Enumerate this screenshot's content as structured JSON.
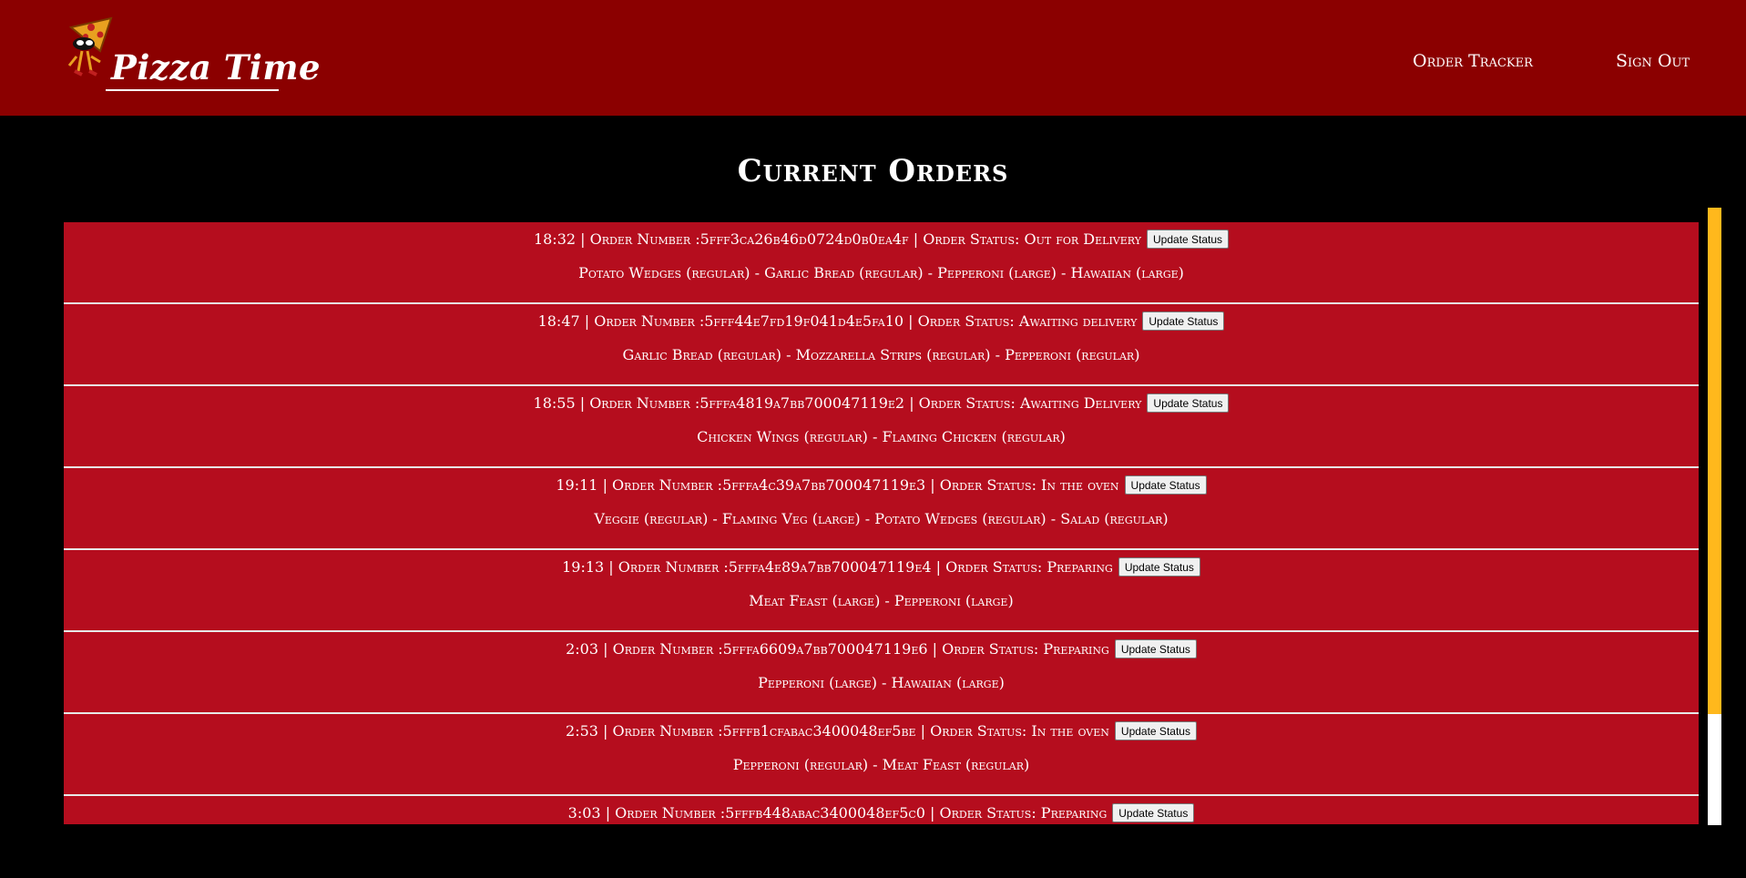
{
  "header": {
    "logo_text": "Pizza Time",
    "nav": {
      "tracker": "Order Tracker",
      "signout": "Sign Out"
    }
  },
  "page": {
    "title": "Current Orders"
  },
  "orders": [
    {
      "line": "18:32 | Order Number :5fff3ca26b46d0724d0b0ea4f | Order Status: Out for Delivery",
      "items": "Potato Wedges (regular) - Garlic Bread (regular) - Pepperoni (large) - Hawaiian (large)",
      "button": "Update Status"
    },
    {
      "line": "18:47 | Order Number :5fff44e7fd19f041d4e5fa10 | Order Status: Awaiting delivery",
      "items": "Garlic Bread (regular) - Mozzarella Strips (regular) - Pepperoni (regular)",
      "button": "Update Status"
    },
    {
      "line": "18:55 | Order Number :5fffa4819a7bb700047119e2 | Order Status: Awaiting Delivery",
      "items": "Chicken Wings (regular) - Flaming Chicken (regular)",
      "button": "Update Status"
    },
    {
      "line": "19:11 | Order Number :5fffa4c39a7bb700047119e3 | Order Status: In the oven",
      "items": "Veggie (regular) - Flaming Veg (large) - Potato Wedges (regular) - Salad (regular)",
      "button": "Update Status"
    },
    {
      "line": "19:13 | Order Number :5fffa4e89a7bb700047119e4 | Order Status: Preparing",
      "items": "Meat Feast (large) - Pepperoni (large)",
      "button": "Update Status"
    },
    {
      "line": "2:03 | Order Number :5fffa6609a7bb700047119e6 | Order Status: Preparing",
      "items": "Pepperoni (large) - Hawaiian (large)",
      "button": "Update Status"
    },
    {
      "line": "2:53 | Order Number :5fffb1cfabac3400048ef5be | Order Status: In the oven",
      "items": "Pepperoni (regular) - Meat Feast (regular)",
      "button": "Update Status"
    },
    {
      "line": "3:03 | Order Number :5fffb448abac3400048ef5c0 | Order Status: Preparing",
      "items": "",
      "button": "Update Status"
    }
  ],
  "colors": {
    "header_bg": "#8b0000",
    "order_bg": "#b50d1e",
    "scroll_thumb": "#ffb81c"
  }
}
